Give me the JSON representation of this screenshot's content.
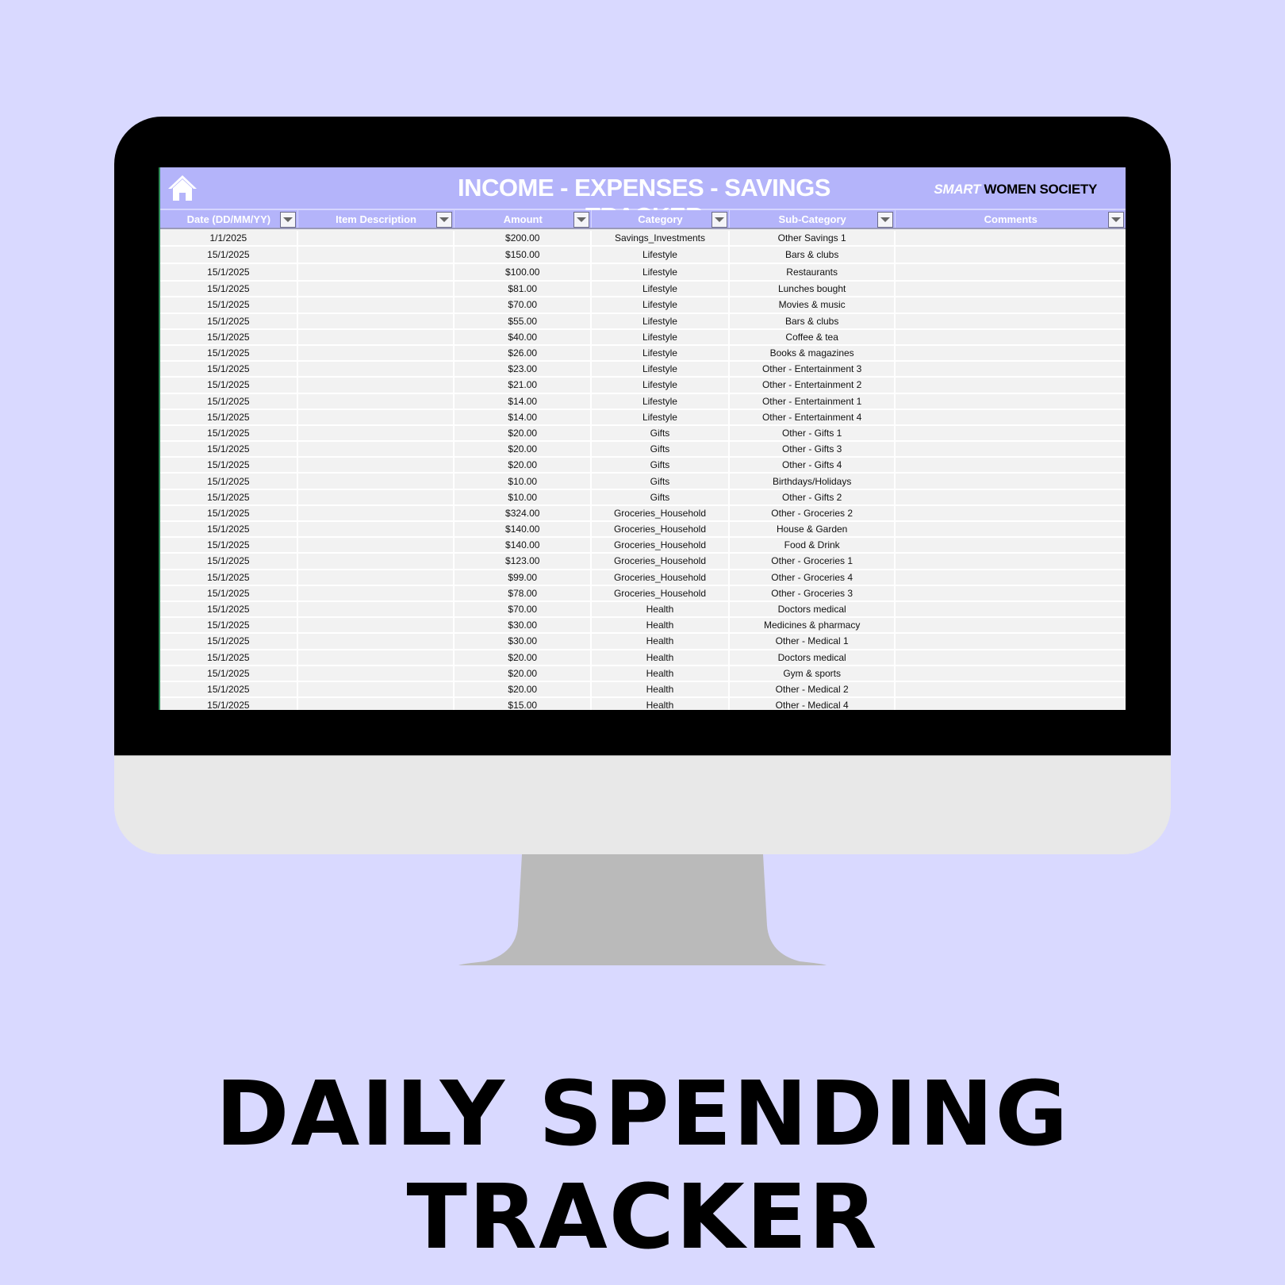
{
  "spreadsheet": {
    "title": "INCOME - EXPENSES - SAVINGS TRACKER",
    "brand_smart": "SMART",
    "brand_rest": "WOMEN SOCIETY",
    "columns": [
      {
        "label": "Date (DD/MM/YY)",
        "filter": true
      },
      {
        "label": "Item Description",
        "filter": true
      },
      {
        "label": "Amount",
        "filter": true
      },
      {
        "label": "Category",
        "filter": true
      },
      {
        "label": "Sub-Category",
        "filter": true
      },
      {
        "label": "Comments",
        "filter": true
      }
    ],
    "rows": [
      {
        "date": "1/1/2025",
        "desc": "",
        "amount": "$200.00",
        "category": "Savings_Investments",
        "subcategory": "Other Savings 1",
        "comments": ""
      },
      {
        "date": "15/1/2025",
        "desc": "",
        "amount": "$150.00",
        "category": "Lifestyle",
        "subcategory": "Bars & clubs",
        "comments": ""
      },
      {
        "date": "15/1/2025",
        "desc": "",
        "amount": "$100.00",
        "category": "Lifestyle",
        "subcategory": "Restaurants",
        "comments": ""
      },
      {
        "date": "15/1/2025",
        "desc": "",
        "amount": "$81.00",
        "category": "Lifestyle",
        "subcategory": "Lunches bought",
        "comments": ""
      },
      {
        "date": "15/1/2025",
        "desc": "",
        "amount": "$70.00",
        "category": "Lifestyle",
        "subcategory": "Movies & music",
        "comments": ""
      },
      {
        "date": "15/1/2025",
        "desc": "",
        "amount": "$55.00",
        "category": "Lifestyle",
        "subcategory": "Bars & clubs",
        "comments": ""
      },
      {
        "date": "15/1/2025",
        "desc": "",
        "amount": "$40.00",
        "category": "Lifestyle",
        "subcategory": "Coffee & tea",
        "comments": ""
      },
      {
        "date": "15/1/2025",
        "desc": "",
        "amount": "$26.00",
        "category": "Lifestyle",
        "subcategory": "Books & magazines",
        "comments": ""
      },
      {
        "date": "15/1/2025",
        "desc": "",
        "amount": "$23.00",
        "category": "Lifestyle",
        "subcategory": "Other - Entertainment 3",
        "comments": ""
      },
      {
        "date": "15/1/2025",
        "desc": "",
        "amount": "$21.00",
        "category": "Lifestyle",
        "subcategory": "Other - Entertainment 2",
        "comments": ""
      },
      {
        "date": "15/1/2025",
        "desc": "",
        "amount": "$14.00",
        "category": "Lifestyle",
        "subcategory": "Other - Entertainment 1",
        "comments": ""
      },
      {
        "date": "15/1/2025",
        "desc": "",
        "amount": "$14.00",
        "category": "Lifestyle",
        "subcategory": "Other - Entertainment 4",
        "comments": ""
      },
      {
        "date": "15/1/2025",
        "desc": "",
        "amount": "$20.00",
        "category": "Gifts",
        "subcategory": "Other - Gifts 1",
        "comments": ""
      },
      {
        "date": "15/1/2025",
        "desc": "",
        "amount": "$20.00",
        "category": "Gifts",
        "subcategory": "Other - Gifts 3",
        "comments": ""
      },
      {
        "date": "15/1/2025",
        "desc": "",
        "amount": "$20.00",
        "category": "Gifts",
        "subcategory": "Other - Gifts 4",
        "comments": ""
      },
      {
        "date": "15/1/2025",
        "desc": "",
        "amount": "$10.00",
        "category": "Gifts",
        "subcategory": "Birthdays/Holidays",
        "comments": ""
      },
      {
        "date": "15/1/2025",
        "desc": "",
        "amount": "$10.00",
        "category": "Gifts",
        "subcategory": "Other - Gifts 2",
        "comments": ""
      },
      {
        "date": "15/1/2025",
        "desc": "",
        "amount": "$324.00",
        "category": "Groceries_Household",
        "subcategory": "Other - Groceries 2",
        "comments": ""
      },
      {
        "date": "15/1/2025",
        "desc": "",
        "amount": "$140.00",
        "category": "Groceries_Household",
        "subcategory": "House & Garden",
        "comments": ""
      },
      {
        "date": "15/1/2025",
        "desc": "",
        "amount": "$140.00",
        "category": "Groceries_Household",
        "subcategory": "Food & Drink",
        "comments": ""
      },
      {
        "date": "15/1/2025",
        "desc": "",
        "amount": "$123.00",
        "category": "Groceries_Household",
        "subcategory": "Other - Groceries 1",
        "comments": ""
      },
      {
        "date": "15/1/2025",
        "desc": "",
        "amount": "$99.00",
        "category": "Groceries_Household",
        "subcategory": "Other - Groceries 4",
        "comments": ""
      },
      {
        "date": "15/1/2025",
        "desc": "",
        "amount": "$78.00",
        "category": "Groceries_Household",
        "subcategory": "Other - Groceries 3",
        "comments": ""
      },
      {
        "date": "15/1/2025",
        "desc": "",
        "amount": "$70.00",
        "category": "Health",
        "subcategory": "Doctors medical",
        "comments": ""
      },
      {
        "date": "15/1/2025",
        "desc": "",
        "amount": "$30.00",
        "category": "Health",
        "subcategory": "Medicines & pharmacy",
        "comments": ""
      },
      {
        "date": "15/1/2025",
        "desc": "",
        "amount": "$30.00",
        "category": "Health",
        "subcategory": "Other - Medical 1",
        "comments": ""
      },
      {
        "date": "15/1/2025",
        "desc": "",
        "amount": "$20.00",
        "category": "Health",
        "subcategory": "Doctors medical",
        "comments": ""
      },
      {
        "date": "15/1/2025",
        "desc": "",
        "amount": "$20.00",
        "category": "Health",
        "subcategory": "Gym & sports",
        "comments": ""
      },
      {
        "date": "15/1/2025",
        "desc": "",
        "amount": "$20.00",
        "category": "Health",
        "subcategory": "Other - Medical 2",
        "comments": ""
      },
      {
        "date": "15/1/2025",
        "desc": "",
        "amount": "$15.00",
        "category": "Health",
        "subcategory": "Other - Medical 4",
        "comments": ""
      }
    ]
  },
  "caption": "DAILY SPENDING TRACKER",
  "colors": {
    "background": "#d9d9ff",
    "header": "#b4b4fa",
    "cell": "#f2f2f2",
    "bezel": "#000000",
    "chin": "#e8e8e8",
    "stand": "#bababa"
  }
}
